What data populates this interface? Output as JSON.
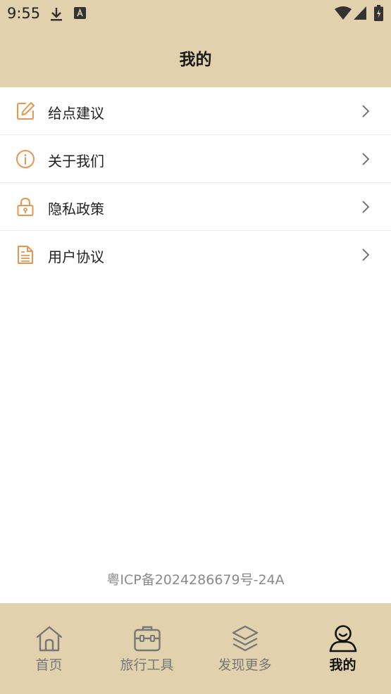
{
  "status_bar": {
    "time": "9:55"
  },
  "header": {
    "title": "我的"
  },
  "menu": {
    "items": [
      {
        "label": "给点建议",
        "icon": "edit-icon"
      },
      {
        "label": "关于我们",
        "icon": "info-icon"
      },
      {
        "label": "隐私政策",
        "icon": "lock-icon"
      },
      {
        "label": "用户协议",
        "icon": "document-icon"
      }
    ]
  },
  "footer": {
    "icp": "粤ICP备2024286679号-24A"
  },
  "tabbar": {
    "tabs": [
      {
        "label": "首页",
        "icon": "home-icon",
        "active": false
      },
      {
        "label": "旅行工具",
        "icon": "toolbox-icon",
        "active": false
      },
      {
        "label": "发现更多",
        "icon": "layers-icon",
        "active": false
      },
      {
        "label": "我的",
        "icon": "user-icon",
        "active": true
      }
    ]
  },
  "colors": {
    "header_bg": "#e1d1ad",
    "accent": "#e8964e",
    "tab_inactive": "#777777",
    "tab_active": "#111111"
  }
}
